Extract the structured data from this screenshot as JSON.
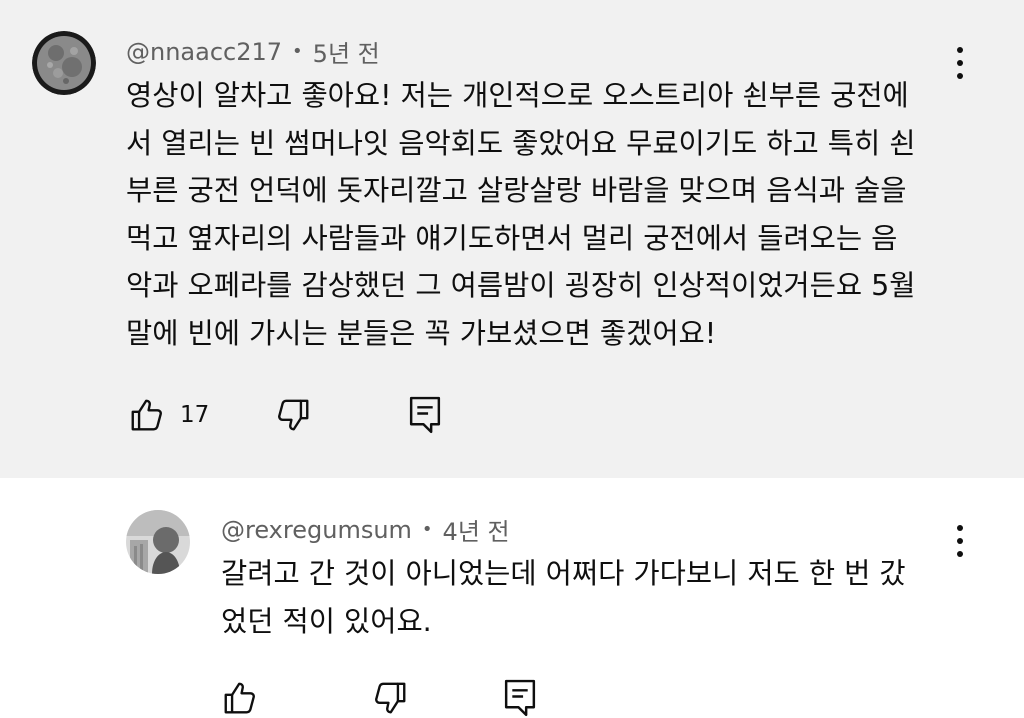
{
  "comment": {
    "author": "@nnaacc217",
    "time": "5년 전",
    "lines": [
      "영상이 알차고 좋아요! 저는 개인적으로 오스트리아 쇤부른 궁전에",
      "서 열리는 빈 썸머나잇 음악회도 좋았어요 무료이기도 하고 특히 쇤",
      "부른 궁전 언덕에 돗자리깔고 살랑살랑 바람을 맞으며 음식과 술을",
      "먹고 옆자리의 사람들과 얘기도하면서 멀리 궁전에서 들려오는 음",
      "악과 오페라를 감상했던 그 여름밤이 굉장히 인상적이었거든요 5월",
      "말에 빈에 가시는 분들은 꼭 가보셨으면 좋겠어요!"
    ],
    "like_count": "17",
    "icons": {
      "like": "thumbs-up-icon",
      "dislike": "thumbs-down-icon",
      "reply": "comment-icon",
      "menu": "more-vertical-icon"
    }
  },
  "reply": {
    "author": "@rexregumsum",
    "time": "4년 전",
    "lines": [
      "갈려고 간 것이 아니었는데 어쩌다 가다보니 저도 한 번 갔",
      "었던 적이 있어요."
    ]
  },
  "colors": {
    "highlight_bg": "#f1f1f1",
    "background": "#ffffff",
    "text": "#0f0f0f",
    "meta_text": "#606060"
  }
}
